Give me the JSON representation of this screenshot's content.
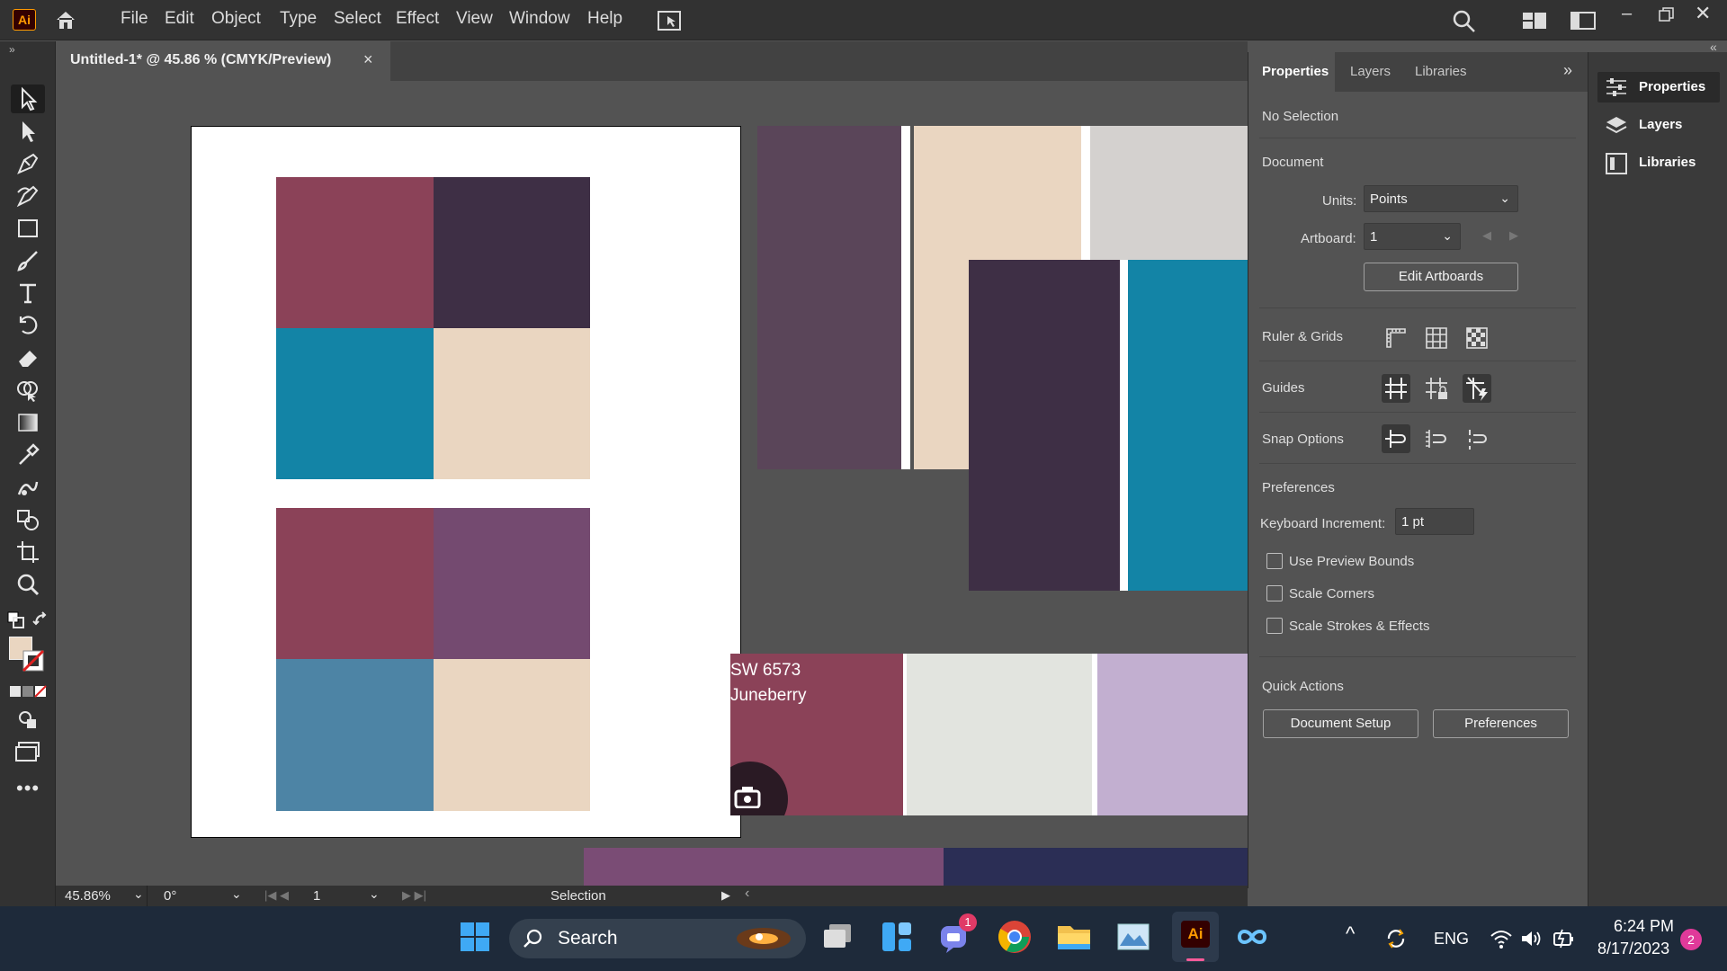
{
  "menubar": {
    "logo": "Ai",
    "items": [
      "File",
      "Edit",
      "Object",
      "Type",
      "Select",
      "Effect",
      "View",
      "Window",
      "Help"
    ]
  },
  "document": {
    "tab_title": "Untitled-1* @ 45.86 % (CMYK/Preview)",
    "close": "×"
  },
  "canvas": {
    "swatch_label_line1": "SW 6573",
    "swatch_label_line2": "Juneberry",
    "colors": {
      "berry": "#8b4258",
      "dark_plum": "#3e2f45",
      "teal": "#1384a6",
      "cream": "#ead6c1",
      "purple": "#744a70",
      "steel_blue": "#4d84a5",
      "mauve": "#5a4559",
      "light_gray": "#d4d1cf",
      "pale_gray": "#e2e4df",
      "lavender": "#c2afd0",
      "navy": "#2b2e55",
      "purple_strip": "#7a4c75"
    }
  },
  "statusbar": {
    "zoom": "45.86%",
    "rotation": "0°",
    "artboard_num": "1",
    "mode": "Selection"
  },
  "properties": {
    "tabs": [
      "Properties",
      "Layers",
      "Libraries"
    ],
    "no_selection": "No Selection",
    "document_heading": "Document",
    "units_label": "Units:",
    "units_value": "Points",
    "artboard_label": "Artboard:",
    "artboard_value": "1",
    "edit_artboards": "Edit Artboards",
    "ruler_grids": "Ruler & Grids",
    "guides": "Guides",
    "snap_options": "Snap Options",
    "preferences_heading": "Preferences",
    "keyboard_increment_label": "Keyboard Increment:",
    "keyboard_increment_value": "1 pt",
    "use_preview_bounds": "Use Preview Bounds",
    "scale_corners": "Scale Corners",
    "scale_strokes": "Scale Strokes & Effects",
    "quick_actions": "Quick Actions",
    "document_setup": "Document Setup",
    "preferences_button": "Preferences"
  },
  "dock": {
    "items": [
      "Properties",
      "Layers",
      "Libraries"
    ]
  },
  "taskbar": {
    "search": "Search",
    "lang": "ENG",
    "time": "6:24 PM",
    "date": "8/17/2023",
    "notifications": "2",
    "teams_badge": "1",
    "ai_label": "Ai"
  }
}
